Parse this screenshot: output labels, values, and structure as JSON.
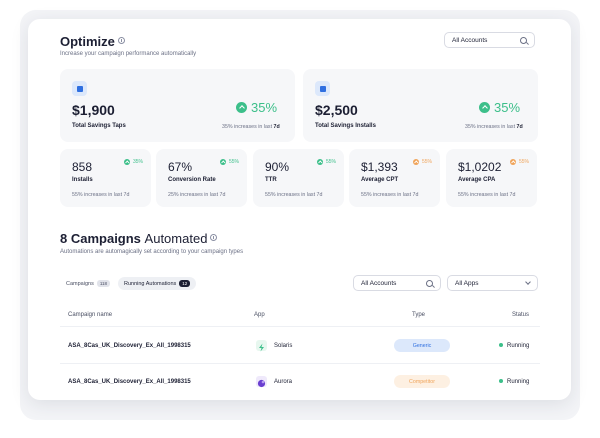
{
  "header": {
    "title": "Optimize",
    "subtitle": "Increase your campaign performance automatically",
    "account_select": "All Accounts"
  },
  "savings": [
    {
      "value": "$1,900",
      "label": "Total Savings Taps",
      "pct": "35%",
      "note_prefix": "35% increases in last",
      "note_period": "7d"
    },
    {
      "value": "$2,500",
      "label": "Total Savings Installs",
      "pct": "35%",
      "note_prefix": "35% increases in last",
      "note_period": "7d"
    }
  ],
  "metrics": [
    {
      "value": "858",
      "label": "Installs",
      "pct": "35%",
      "trend": "green",
      "note": "55% increases in last 7d"
    },
    {
      "value": "67%",
      "label": "Conversion Rate",
      "pct": "55%",
      "trend": "green",
      "note": "25% increases in last 7d"
    },
    {
      "value": "90%",
      "label": "TTR",
      "pct": "55%",
      "trend": "green",
      "note": "55% increases in last 7d"
    },
    {
      "value": "$1,393",
      "label": "Average CPT",
      "pct": "55%",
      "trend": "orange",
      "note": "55% increases in last 7d"
    },
    {
      "value": "$1,0202",
      "label": "Average CPA",
      "pct": "55%",
      "trend": "orange",
      "note": "55% increases in last 7d"
    }
  ],
  "campaigns": {
    "title_bold": "8 Campaigns",
    "title_light": "Automated",
    "subtitle": "Automations are automagically set according to your campaign types",
    "tabs": [
      {
        "label": "Campaigns",
        "count": "118"
      },
      {
        "label": "Running Automations",
        "count": "12"
      }
    ],
    "account_select": "All Accounts",
    "apps_select": "All Apps",
    "columns": {
      "name": "Campaign name",
      "app": "App",
      "type": "Type",
      "status": "Status"
    },
    "rows": [
      {
        "name": "ASA_8Cas_UK_Discovery_Ex_All_1998315",
        "app": "Solaris",
        "type": "Generic",
        "status": "Running"
      },
      {
        "name": "ASA_8Cas_UK_Discovery_Ex_All_1998315",
        "app": "Aurora",
        "type": "Competitor",
        "status": "Running"
      }
    ]
  },
  "colors": {
    "accent_green": "#3cbf8a",
    "accent_orange": "#f0a45a",
    "accent_blue": "#2f6fe0",
    "generic_pill": "#dce8fb",
    "competitor_pill": "#fdf0e2"
  },
  "icons": [
    "info-icon",
    "search-icon",
    "chevron-down-icon",
    "trend-up-icon",
    "app-badge-icon",
    "solaris-app-icon",
    "aurora-app-icon"
  ]
}
